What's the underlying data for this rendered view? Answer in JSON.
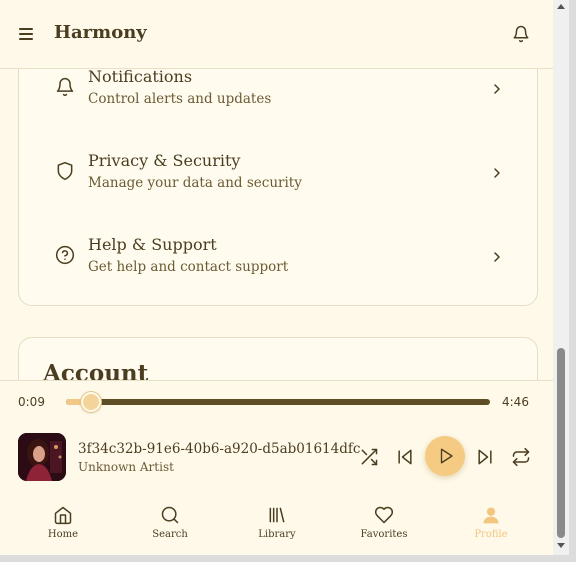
{
  "header": {
    "title": "Harmony"
  },
  "settings": [
    {
      "title": "Notifications",
      "subtitle": "Control alerts and updates",
      "icon": "bell-icon"
    },
    {
      "title": "Privacy & Security",
      "subtitle": "Manage your data and security",
      "icon": "shield-icon"
    },
    {
      "title": "Help & Support",
      "subtitle": "Get help and contact support",
      "icon": "help-circle-icon"
    }
  ],
  "account": {
    "title": "Account"
  },
  "player": {
    "current_time": "0:09",
    "total_time": "4:46",
    "progress": 0.054,
    "song_title": "3f34c32b-91e6-40b6-a920-d5ab01614dfc",
    "artist": "Unknown Artist"
  },
  "nav": [
    {
      "label": "Home",
      "icon": "home-icon"
    },
    {
      "label": "Search",
      "icon": "search-icon"
    },
    {
      "label": "Library",
      "icon": "library-icon"
    },
    {
      "label": "Favorites",
      "icon": "heart-icon"
    },
    {
      "label": "Profile",
      "icon": "profile-icon",
      "active": true
    }
  ],
  "colors": {
    "accent": "#f5cb84",
    "text": "#4a3d20",
    "background": "#fef9e9"
  }
}
